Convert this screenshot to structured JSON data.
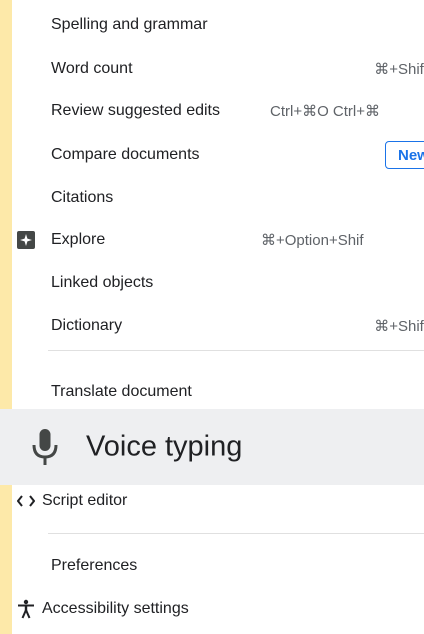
{
  "menu": {
    "items": [
      {
        "label": "Spelling and grammar",
        "shortcut": ""
      },
      {
        "label": "Word count",
        "shortcut": "⌘+Shift"
      },
      {
        "label": "Review suggested edits",
        "shortcut": "Ctrl+⌘O Ctrl+⌘"
      },
      {
        "label": "Compare documents",
        "badge": "New"
      },
      {
        "label": "Citations",
        "shortcut": ""
      },
      {
        "label": "Explore",
        "shortcut": "⌘+Option+Shif",
        "icon": "explore-icon"
      },
      {
        "label": "Linked objects",
        "shortcut": ""
      },
      {
        "label": "Dictionary",
        "shortcut": "⌘+Shift"
      },
      {
        "label": "Translate document",
        "shortcut": ""
      },
      {
        "label": "Script editor",
        "shortcut": "",
        "icon": "code-icon"
      },
      {
        "label": "Preferences",
        "shortcut": ""
      },
      {
        "label": "Accessibility settings",
        "shortcut": "",
        "icon": "accessibility-icon"
      }
    ],
    "voice_typing": {
      "label": "Voice typing",
      "icon": "microphone-icon"
    }
  },
  "colors": {
    "left_strip": "#fde9a9",
    "highlight_band": "#eeeff1",
    "badge_blue": "#1a73e8",
    "text": "#202124",
    "shortcut_text": "#5f6368"
  }
}
